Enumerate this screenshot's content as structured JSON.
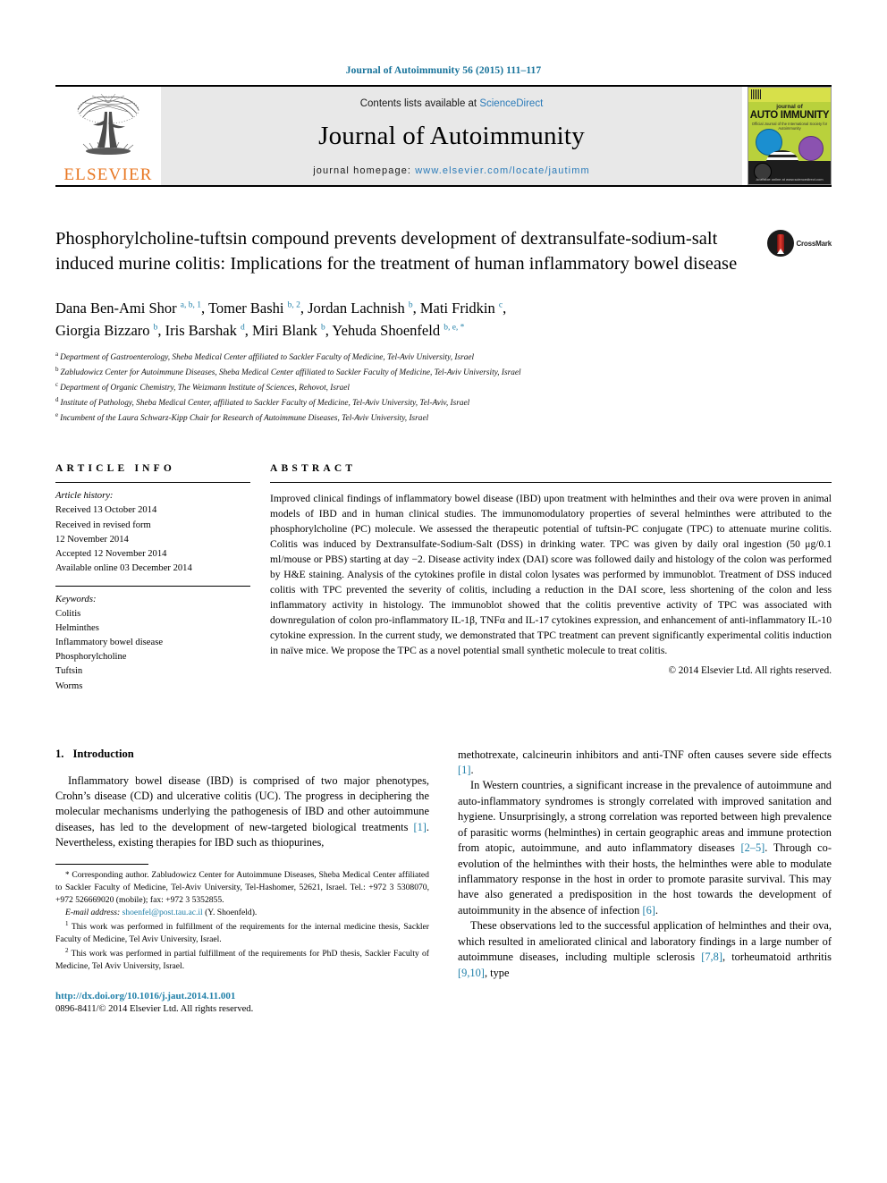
{
  "running_head": "Journal of Autoimmunity 56 (2015) 111–117",
  "masthead": {
    "publisher": "ELSEVIER",
    "contents_prefix": "Contents lists available at ",
    "contents_link": "ScienceDirect",
    "journal_name": "Journal of Autoimmunity",
    "homepage_prefix": "journal homepage: ",
    "homepage_url": "www.elsevier.com/locate/jautimm",
    "cover": {
      "kicker": "journal of",
      "title": "AUTO IMMUNITY",
      "subtitle": "Official Journal of the International Society for Autoimmunity",
      "footer": "Available online at www.sciencedirect.com"
    }
  },
  "article": {
    "title": "Phosphorylcholine-tuftsin compound prevents development of dextransulfate-sodium-salt induced murine colitis: Implications for the treatment of human inflammatory bowel disease",
    "crossmark_label": "CrossMark",
    "authors": [
      {
        "name": "Dana Ben-Ami Shor",
        "marks": "a, b, 1",
        "sep": ", "
      },
      {
        "name": "Tomer Bashi",
        "marks": "b, 2",
        "sep": ", "
      },
      {
        "name": "Jordan Lachnish",
        "marks": "b",
        "sep": ", "
      },
      {
        "name": "Mati Fridkin",
        "marks": "c",
        "sep": ", "
      },
      {
        "name": "Giorgia Bizzaro",
        "marks": "b",
        "sep": ", "
      },
      {
        "name": "Iris Barshak",
        "marks": "d",
        "sep": ", "
      },
      {
        "name": "Miri Blank",
        "marks": "b",
        "sep": ", "
      },
      {
        "name": "Yehuda Shoenfeld",
        "marks": "b, e, *",
        "sep": ""
      }
    ],
    "affiliations": [
      {
        "mark": "a",
        "text": "Department of Gastroenterology, Sheba Medical Center affiliated to Sackler Faculty of Medicine, Tel-Aviv University, Israel"
      },
      {
        "mark": "b",
        "text": "Zabludowicz Center for Autoimmune Diseases, Sheba Medical Center affiliated to Sackler Faculty of Medicine, Tel-Aviv University, Israel"
      },
      {
        "mark": "c",
        "text": "Department of Organic Chemistry, The Weizmann Institute of Sciences, Rehovot, Israel"
      },
      {
        "mark": "d",
        "text": "Institute of Pathology, Sheba Medical Center, affiliated to Sackler Faculty of Medicine, Tel-Aviv University, Tel-Aviv, Israel"
      },
      {
        "mark": "e",
        "text": "Incumbent of the Laura Schwarz-Kipp Chair for Research of Autoimmune Diseases, Tel-Aviv University, Israel"
      }
    ]
  },
  "article_info": {
    "heading": "ARTICLE INFO",
    "history_label": "Article history:",
    "history": [
      "Received 13 October 2014",
      "Received in revised form",
      "12 November 2014",
      "Accepted 12 November 2014",
      "Available online 03 December 2014"
    ],
    "keywords_label": "Keywords:",
    "keywords": [
      "Colitis",
      "Helminthes",
      "Inflammatory bowel disease",
      "Phosphorylcholine",
      "Tuftsin",
      "Worms"
    ]
  },
  "abstract": {
    "heading": "ABSTRACT",
    "text": "Improved clinical findings of inflammatory bowel disease (IBD) upon treatment with helminthes and their ova were proven in animal models of IBD and in human clinical studies. The immunomodulatory properties of several helminthes were attributed to the phosphorylcholine (PC) molecule. We assessed the therapeutic potential of tuftsin-PC conjugate (TPC) to attenuate murine colitis. Colitis was induced by Dextransulfate-Sodium-Salt (DSS) in drinking water. TPC was given by daily oral ingestion (50 μg/0.1 ml/mouse or PBS) starting at day −2. Disease activity index (DAI) score was followed daily and histology of the colon was performed by H&E staining. Analysis of the cytokines profile in distal colon lysates was performed by immunoblot. Treatment of DSS induced colitis with TPC prevented the severity of colitis, including a reduction in the DAI score, less shortening of the colon and less inflammatory activity in histology. The immunoblot showed that the colitis preventive activity of TPC was associated with downregulation of colon pro-inflammatory IL-1β, TNFα and IL-17 cytokines expression, and enhancement of anti-inflammatory IL-10 cytokine expression. In the current study, we demonstrated that TPC treatment can prevent significantly experimental colitis induction in naïve mice. We propose the TPC as a novel potential small synthetic molecule to treat colitis.",
    "rights": "© 2014 Elsevier Ltd. All rights reserved."
  },
  "introduction": {
    "number": "1.",
    "title": "Introduction",
    "left_paragraph_1a": "Inflammatory bowel disease (IBD) is comprised of two major phenotypes, Crohn’s disease (CD) and ulcerative colitis (UC). The progress in deciphering the molecular mechanisms underlying the pathogenesis of IBD and other autoimmune diseases, has led to the development of new-targeted biological treatments ",
    "left_ref_1": "[1]",
    "left_paragraph_1b": ". Nevertheless, existing therapies for IBD such as thiopurines,",
    "right_paragraph_1a": "methotrexate, calcineurin inhibitors and anti-TNF often causes severe side effects ",
    "right_ref_1": "[1]",
    "right_paragraph_1b": ".",
    "right_paragraph_2a": "In Western countries, a significant increase in the prevalence of autoimmune and auto-inflammatory syndromes is strongly correlated with improved sanitation and hygiene. Unsurprisingly, a strong correlation was reported between high prevalence of parasitic worms (helminthes) in certain geographic areas and immune protection from atopic, autoimmune, and auto inflammatory diseases ",
    "right_ref_2": "[2–5]",
    "right_paragraph_2b": ". Through co-evolution of the helminthes with their hosts, the helminthes were able to modulate inflammatory response in the host in order to promote parasite survival. This may have also generated a predisposition in the host towards the development of autoimmunity in the absence of infection ",
    "right_ref_3": "[6]",
    "right_paragraph_2c": ".",
    "right_paragraph_3a": "These observations led to the successful application of helminthes and their ova, which resulted in ameliorated clinical and laboratory findings in a large number of autoimmune diseases, including multiple sclerosis ",
    "right_ref_4": "[7,8]",
    "right_paragraph_3b": ", torheumatoid arthritis ",
    "right_ref_5": "[9,10]",
    "right_paragraph_3c": ", type"
  },
  "footnotes": {
    "corresponding": "Corresponding author. Zabludowicz Center for Autoimmune Diseases, Sheba Medical Center affiliated to Sackler Faculty of Medicine, Tel-Aviv University, Tel-Hashomer, 52621, Israel. Tel.: +972 3 5308070, +972 526669020 (mobile); fax: +972 3 5352855.",
    "email_label": "E-mail address:",
    "email": "shoenfel@post.tau.ac.il",
    "email_owner": "(Y. Shoenfeld).",
    "note1_mark": "1",
    "note1": "This work was performed in fulfillment of the requirements for the internal medicine thesis, Sackler Faculty of Medicine, Tel Aviv University, Israel.",
    "note2_mark": "2",
    "note2": "This work was performed in partial fulfillment of the requirements for PhD thesis, Sackler Faculty of Medicine, Tel Aviv University, Israel."
  },
  "footer": {
    "doi": "http://dx.doi.org/10.1016/j.jaut.2014.11.001",
    "issn": "0896-8411/© 2014 Elsevier Ltd. All rights reserved."
  },
  "colors": {
    "link": "#1f7fa8",
    "sciencedirect": "#2b7bb9",
    "elsevier_orange": "#e87722",
    "masthead_bg": "#e8e8e8"
  }
}
